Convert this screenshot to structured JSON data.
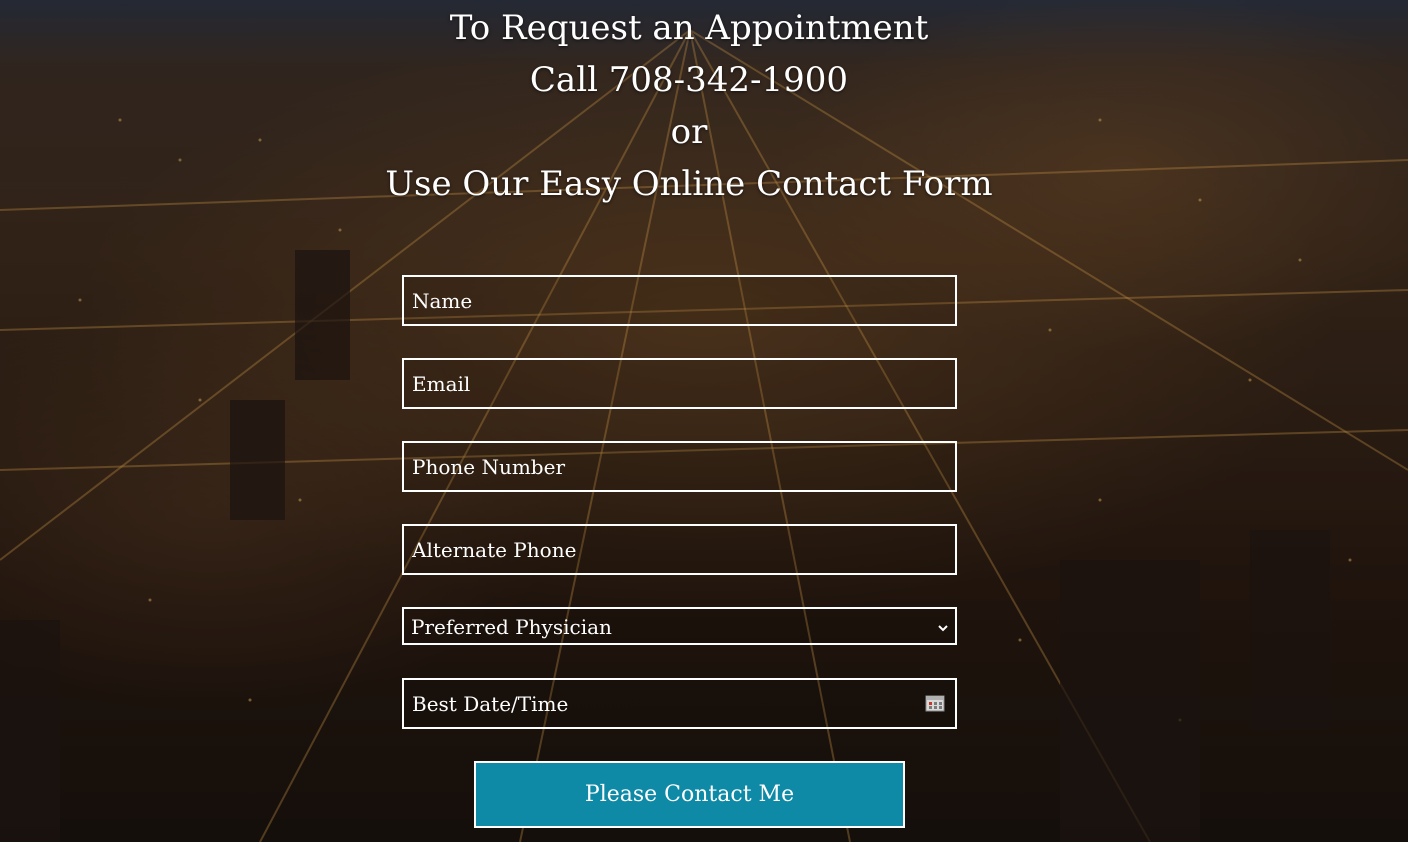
{
  "heading": {
    "line1": "To Request an Appointment",
    "line2": "Call 708-342-1900",
    "line3": "or",
    "line4": "Use Our Easy Online Contact Form"
  },
  "form": {
    "name_placeholder": "Name",
    "email_placeholder": "Email",
    "phone_placeholder": "Phone Number",
    "alt_phone_placeholder": "Alternate Phone",
    "physician_selected": "Preferred Physician",
    "datetime_placeholder": "Best Date/Time",
    "submit_label": "Please Contact Me"
  },
  "colors": {
    "button_bg": "#0e8aa6",
    "text": "#ffffff",
    "border": "#ffffff"
  },
  "icons": {
    "select_arrow": "chevron-down-icon",
    "date_picker": "calendar-icon"
  }
}
